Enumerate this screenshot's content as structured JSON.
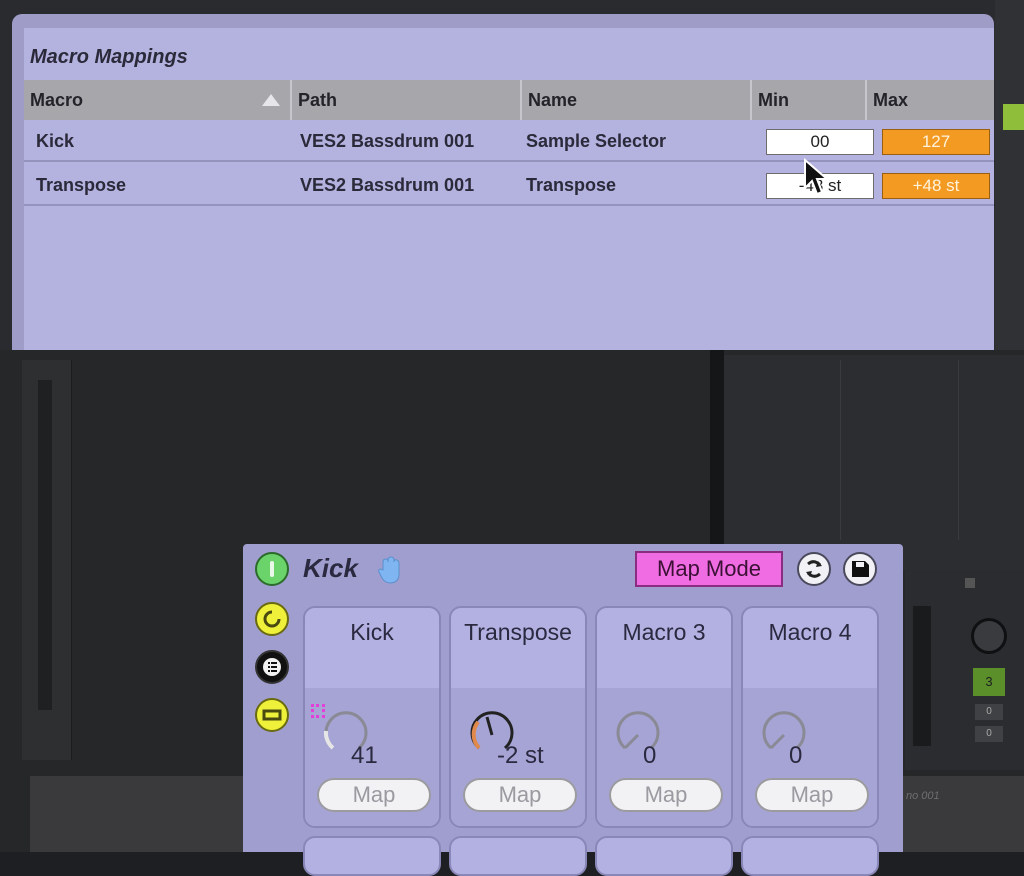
{
  "macro_mappings": {
    "title": "Macro Mappings",
    "columns": [
      "Macro",
      "Path",
      "Name",
      "Min",
      "Max"
    ],
    "rows": [
      {
        "macro": "Kick",
        "path": "VES2 Bassdrum 001",
        "name": "Sample Selector",
        "min": "00",
        "max": "127"
      },
      {
        "macro": "Transpose",
        "path": "VES2 Bassdrum 001",
        "name": "Transpose",
        "min": "-48 st",
        "max": "+48 st"
      }
    ]
  },
  "device": {
    "title": "Kick",
    "map_mode_label": "Map Mode",
    "macros": [
      {
        "label": "Kick",
        "value": "41",
        "map": "Map",
        "knob_level": 0.32,
        "color": "#e6e6e6"
      },
      {
        "label": "Transpose",
        "value": "-2 st",
        "map": "Map",
        "knob_level": 0.48,
        "color": "#e0894a"
      },
      {
        "label": "Macro  3",
        "value": "0",
        "map": "Map",
        "knob_level": 0,
        "color": "#8a8a96"
      },
      {
        "label": "Macro  4",
        "value": "0",
        "map": "Map",
        "knob_level": 0,
        "color": "#8a8a96"
      }
    ]
  },
  "background": {
    "clip_name": "no 001",
    "mixer_value": "3",
    "mixer_send_a": "0",
    "mixer_send_b": "0"
  },
  "icons": [
    "sort-ascending-icon",
    "mouse-pointer-icon",
    "power-icon",
    "hand-icon",
    "hot-swap-icon",
    "save-icon",
    "circle-arrow-icon",
    "list-icon",
    "chain-icon"
  ]
}
